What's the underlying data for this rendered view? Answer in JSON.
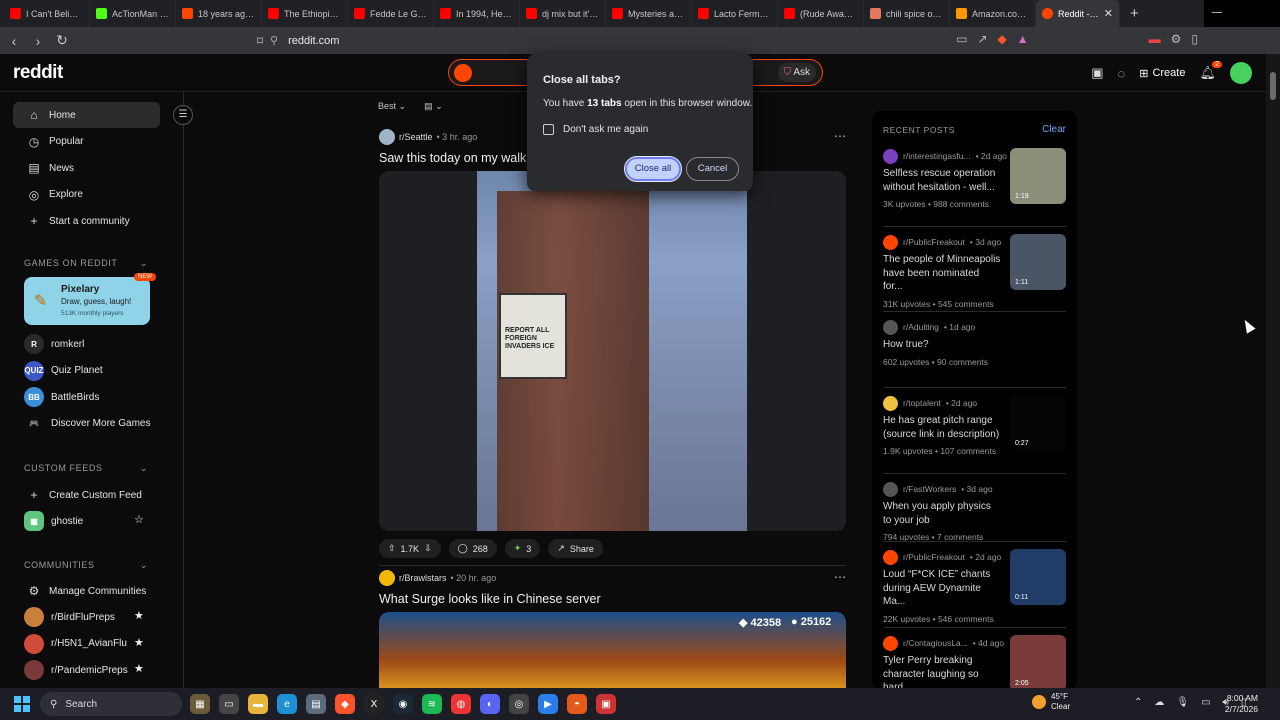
{
  "browser": {
    "tabs": [
      {
        "label": "I Can't Believe T",
        "color": "#ff0000"
      },
      {
        "label": "AcTionMan Stre",
        "color": "#53fc18"
      },
      {
        "label": "18 years ago to",
        "color": "#ff4500"
      },
      {
        "label": "The Ethiopian B",
        "color": "#ff0000"
      },
      {
        "label": "Fedde Le Grand",
        "color": "#ff0000"
      },
      {
        "label": "In 1994, He Exp",
        "color": "#ff0000"
      },
      {
        "label": "dj mix but it's n",
        "color": "#ff0000"
      },
      {
        "label": "Mysteries and C",
        "color": "#ff0000"
      },
      {
        "label": "Lacto Fermente",
        "color": "#ff0000"
      },
      {
        "label": "(Rude Awakeni",
        "color": "#ff0000"
      },
      {
        "label": "chili spice oil b",
        "color": "#e07a5f"
      },
      {
        "label": "Amazon.com S",
        "color": "#ff9900"
      }
    ],
    "active_tab": "Reddit - Th",
    "new_tab": "+",
    "url": "reddit.com"
  },
  "header": {
    "logo": "reddit",
    "ask_label": "Ask",
    "create_label": "Create",
    "notif_count": "2"
  },
  "sidebar": {
    "nav": [
      {
        "label": "Home",
        "icon": "⌂"
      },
      {
        "label": "Popular",
        "icon": "◷"
      },
      {
        "label": "News",
        "icon": "▤"
      },
      {
        "label": "Explore",
        "icon": "◎"
      },
      {
        "label": "Start a community",
        "icon": "+"
      }
    ],
    "games_heading": "GAMES ON REDDIT",
    "featured_game": {
      "name": "Pixelary",
      "desc": "Draw, guess, laugh!",
      "count": "513K monthly players",
      "badge": "NEW"
    },
    "games": [
      {
        "label": "romkerl",
        "color": "#2b2b2b",
        "glyph": "R"
      },
      {
        "label": "Quiz Planet",
        "color": "#3b58c4",
        "glyph": "QUIZ"
      },
      {
        "label": "BattleBirds",
        "color": "#3a8fd6",
        "glyph": "BB"
      },
      {
        "label": "Discover More Games",
        "color": "transparent",
        "glyph": "🎮"
      }
    ],
    "custom_heading": "CUSTOM FEEDS",
    "create_feed": "Create Custom Feed",
    "feed": "ghostie",
    "communities_heading": "COMMUNITIES",
    "manage": "Manage Communities",
    "communities": [
      {
        "label": "r/BirdFluPreps",
        "color": "#c9803a"
      },
      {
        "label": "r/H5N1_AvianFlu",
        "color": "#d14a3a"
      },
      {
        "label": "r/PandemicPreps",
        "color": "#7a3a3a"
      }
    ]
  },
  "feed": {
    "sort": "Best",
    "posts": [
      {
        "sub": "r/Seattle",
        "time": "• 3 hr. ago",
        "title": "Saw this today on my walk",
        "votes": "1.7K",
        "comments": "268",
        "awards": "3",
        "share": "Share",
        "sign_text": "REPORT ALL FOREIGN INVADERS ICE"
      },
      {
        "sub": "r/Brawlstars",
        "time": "• 20 hr. ago",
        "title": "What Surge looks like in Chinese server",
        "stat1": "42358",
        "stat2": "25162"
      }
    ]
  },
  "recent": {
    "heading": "RECENT POSTS",
    "clear": "Clear",
    "items": [
      {
        "sub": "r/interestingasfu...",
        "age": "• 2d ago",
        "title": "Selfless rescue operation without hesitation - well...",
        "stats": "3K upvotes  •  988 comments",
        "dur": "1:19",
        "thumb": "#8a8f7a",
        "icon": "#7b3fbf"
      },
      {
        "sub": "r/PublicFreakout",
        "age": "• 3d ago",
        "title": "The people of Minneapolis have been nominated for...",
        "stats": "31K upvotes  •  545 comments",
        "dur": "1:11",
        "thumb": "#4a5566",
        "icon": "#ff4500"
      },
      {
        "sub": "r/Adulting",
        "age": "• 1d ago",
        "title": "How true?",
        "stats": "602 upvotes  •  90 comments",
        "dur": "",
        "thumb": "",
        "icon": "#555"
      },
      {
        "sub": "r/toptalent",
        "age": "• 2d ago",
        "title": "He has great pitch range (source link in description)",
        "stats": "1.9K upvotes  •  107 comments",
        "dur": "0:27",
        "thumb": "#050505",
        "icon": "#f0c040"
      },
      {
        "sub": "r/FastWorkers",
        "age": "• 3d ago",
        "title": "When you apply physics to your job",
        "stats": "794 upvotes  •  7 comments",
        "dur": "",
        "thumb": "",
        "icon": "#555"
      },
      {
        "sub": "r/PublicFreakout",
        "age": "• 2d ago",
        "title": "Loud “F*CK ICE” chants during AEW Dynamite Ma...",
        "stats": "22K upvotes  •  546 comments",
        "dur": "0:11",
        "thumb": "#1f3d66",
        "icon": "#ff4500"
      },
      {
        "sub": "r/ContagiousLa...",
        "age": "• 4d ago",
        "title": "Tyler Perry breaking character laughing so hard",
        "stats": "",
        "dur": "2:05",
        "thumb": "#7a3b3b",
        "icon": "#ff4500"
      }
    ]
  },
  "dialog": {
    "title": "Close all tabs?",
    "body_pre": "You have ",
    "body_bold": "13 tabs",
    "body_post": " open in this browser window.",
    "checkbox": "Don't ask me again",
    "confirm": "Close all",
    "cancel": "Cancel"
  },
  "taskbar": {
    "search": "Search",
    "temp": "45°F",
    "cond": "Clear",
    "time": "8:00 AM",
    "date": "2/7/2026"
  }
}
